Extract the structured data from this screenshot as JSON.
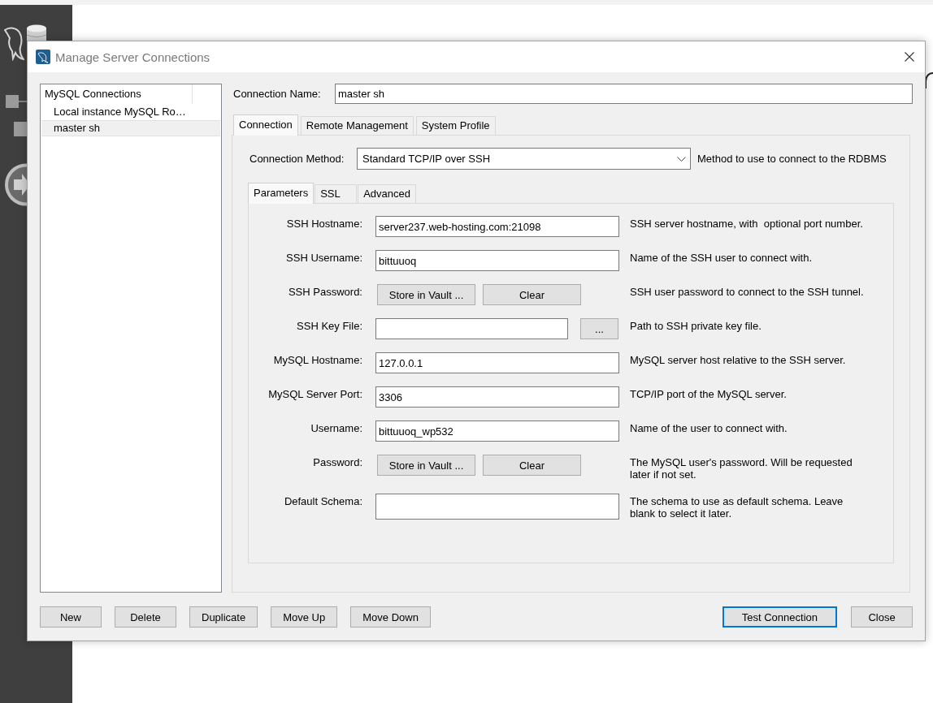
{
  "window": {
    "title": "Manage Server Connections"
  },
  "connections": {
    "header": "MySQL Connections",
    "items": [
      {
        "label": "Local instance MySQL Ro…",
        "selected": false
      },
      {
        "label": "master sh",
        "selected": true
      }
    ]
  },
  "connection_name": {
    "label": "Connection Name:",
    "value": "master sh"
  },
  "tabs": [
    {
      "label": "Connection",
      "selected": true
    },
    {
      "label": "Remote Management",
      "selected": false
    },
    {
      "label": "System Profile",
      "selected": false
    }
  ],
  "connection_method": {
    "label": "Connection Method:",
    "value": "Standard TCP/IP over SSH",
    "description": "Method to use to connect to the RDBMS"
  },
  "parameter_tabs": [
    {
      "label": "Parameters",
      "selected": true
    },
    {
      "label": "SSL",
      "selected": false
    },
    {
      "label": "Advanced",
      "selected": false
    }
  ],
  "parameters": [
    {
      "kind": "text",
      "label": "SSH Hostname:",
      "value": "server237.web-hosting.com:21098",
      "description": "SSH server hostname, with  optional port number."
    },
    {
      "kind": "text",
      "label": "SSH Username:",
      "value": "bittuuoq",
      "description": "Name of the SSH user to connect with."
    },
    {
      "kind": "vault",
      "label": "SSH Password:",
      "store_button": "Store in Vault ...",
      "clear_button": "Clear",
      "description": "SSH user password to connect to the SSH tunnel."
    },
    {
      "kind": "file",
      "label": "SSH Key File:",
      "browse_button": "...",
      "description": "Path to SSH private key file."
    },
    {
      "kind": "text",
      "label": "MySQL Hostname:",
      "value": "127.0.0.1",
      "description": "MySQL server host relative to the SSH server."
    },
    {
      "kind": "text",
      "label": "MySQL Server Port:",
      "value": "3306",
      "description": "TCP/IP port of the MySQL server."
    },
    {
      "kind": "text",
      "label": "Username:",
      "value": "bittuuoq_wp532",
      "description": "Name of the user to connect with."
    },
    {
      "kind": "vault",
      "label": "Password:",
      "store_button": "Store in Vault ...",
      "clear_button": "Clear",
      "description": "The MySQL user's password. Will be requested later if not set."
    },
    {
      "kind": "multiline",
      "label": "Default Schema:",
      "description": "The schema to use as default schema. Leave blank to select it later."
    }
  ],
  "list_buttons": [
    "New",
    "Delete",
    "Duplicate",
    "Move Up",
    "Move Down"
  ],
  "dialog_buttons": [
    {
      "label": "Test Connection",
      "focused": true
    },
    {
      "label": "Close",
      "focused": false
    }
  ]
}
